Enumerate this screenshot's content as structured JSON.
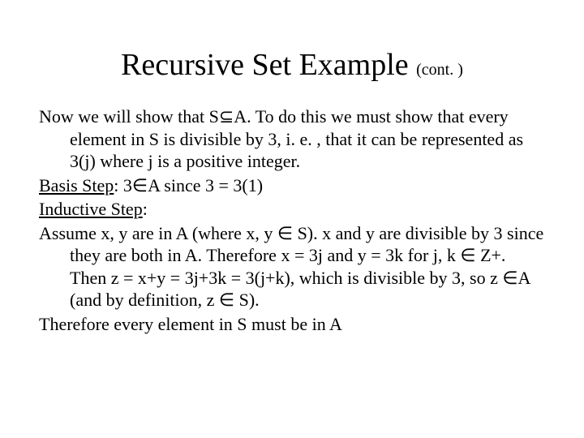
{
  "title": {
    "main": "Recursive Set Example",
    "cont": "(cont. )"
  },
  "body": {
    "p1a": "Now we will show that S",
    "p1b": "A.  To do this we must show that every element in S is divisible by 3, i. e. , that it can be represented as 3(j) where j is a positive integer.",
    "p2_label": "Basis Step",
    "p2a": ": 3",
    "p2b": "A since 3 = 3(1)",
    "p3_label": "Inductive Step",
    "p3a": ":",
    "p4a": "Assume x, y are in A (where x, y ",
    "p4b": " S).  x and y are divisible by 3 since they are both in A.  Therefore x = 3j  and y = 3k for j, k ",
    "p4c": " Z+.  Then z = x+y = 3j+3k = 3(j+k), which is divisible by 3, so z ",
    "p4d": "A (and by definition, z ",
    "p4e": " S).",
    "p5": "Therefore every element in S must be in A"
  },
  "sym": {
    "subset": "⊆",
    "elem": "∈"
  }
}
